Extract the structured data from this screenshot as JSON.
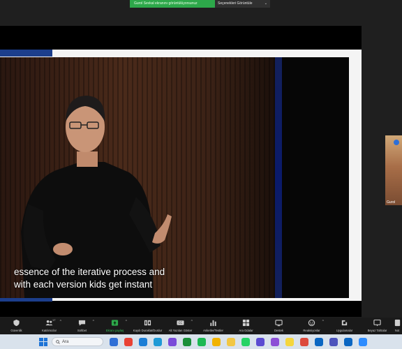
{
  "share_bar": {
    "status": "Gurol Sevkal ekranını görüntülüyorsunuz",
    "view_options": "Seçenekleri Görüntüle",
    "chevron": "⌄"
  },
  "video": {
    "caption_lines": [
      "essence of the iterative process and",
      "with each version kids get instant"
    ]
  },
  "thumbnail": {
    "label": "Gurol"
  },
  "toolbar": {
    "items": [
      {
        "id": "security",
        "label": "Güvenlik",
        "icon": "shield-icon"
      },
      {
        "id": "participants",
        "label": "Katılımcılar",
        "icon": "people-icon",
        "badge": "17"
      },
      {
        "id": "chat",
        "label": "Sohbet",
        "icon": "chat-icon"
      },
      {
        "id": "share",
        "label": "Ekranı paylaş",
        "icon": "share-screen-icon"
      },
      {
        "id": "record",
        "label": "Kaydı Duraklat/Durdur",
        "icon": "pause-stop-icon"
      },
      {
        "id": "captions",
        "label": "Alt Yazıları Göster",
        "icon": "cc-icon"
      },
      {
        "id": "polls",
        "label": "Anketler/Testler",
        "icon": "poll-icon"
      },
      {
        "id": "breakout",
        "label": "Ara Odalar",
        "icon": "breakout-icon"
      },
      {
        "id": "support",
        "label": "Destek",
        "icon": "support-icon"
      },
      {
        "id": "reactions",
        "label": "Reaksiyonlar",
        "icon": "reaction-icon"
      },
      {
        "id": "apps",
        "label": "Uygulamalar",
        "icon": "apps-icon"
      },
      {
        "id": "whiteboards",
        "label": "Beyaz Tahtalar",
        "icon": "whiteboard-icon"
      },
      {
        "id": "notes",
        "label": "Not",
        "icon": "notes-icon"
      }
    ]
  },
  "taskbar": {
    "search_placeholder": "Ara",
    "icons": [
      "file-explorer-icon",
      "chrome-icon",
      "store-icon",
      "edge-icon",
      "photos-icon",
      "xbox-icon",
      "spotify-icon",
      "chrome-alt-icon",
      "folder-icon",
      "whatsapp-icon",
      "media-icon",
      "visual-studio-icon",
      "notes-yellow-icon",
      "chrome-third-icon",
      "mail-icon",
      "teams-icon",
      "linkedin-icon",
      "zoom-icon"
    ],
    "colors": [
      "#2f6fd6",
      "#e94235",
      "#1c7ed6",
      "#1f9ad6",
      "#7a4bd9",
      "#1a8f3a",
      "#1db954",
      "#f1b300",
      "#f2c744",
      "#25d366",
      "#5b4bd1",
      "#8c4fd6",
      "#f5d63d",
      "#dc4a3d",
      "#0a66c2",
      "#4b53bc",
      "#0a66c2",
      "#2d8cff"
    ]
  },
  "colors": {
    "share_green": "#2da84a",
    "accent_blue": "#1c3e8c",
    "toolbar_bg": "#1a1a1a",
    "taskbar_bg": "#d9e2ec"
  }
}
